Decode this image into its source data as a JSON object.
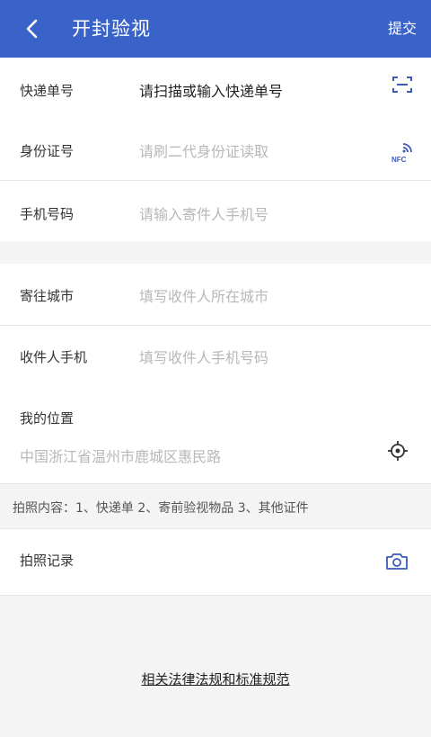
{
  "header": {
    "title": "开封验视",
    "submit_label": "提交",
    "background": "#3a63c9"
  },
  "section1": {
    "rows": [
      {
        "label": "快递单号",
        "placeholder": "请扫描或输入快递单号",
        "icon": "scan-icon"
      },
      {
        "label": "身份证号",
        "placeholder": "请刷二代身份证读取",
        "icon": "nfc-icon",
        "icon_text": "NFC"
      },
      {
        "label": "手机号码",
        "placeholder": "请输入寄件人手机号"
      }
    ]
  },
  "section2": {
    "rows": [
      {
        "label": "寄往城市",
        "placeholder": "填写收件人所在城市"
      },
      {
        "label": "收件人手机",
        "placeholder": "填写收件人手机号码"
      }
    ],
    "location": {
      "label": "我的位置",
      "value": "中国浙江省温州市鹿城区惠民路",
      "icon": "locate-icon"
    }
  },
  "photo_tip": "拍照内容：1、快递单 2、寄前验视物品 3、其他证件",
  "photo_record": {
    "label": "拍照记录",
    "icon": "camera-icon"
  },
  "law_link": "相关法律法规和标准规范"
}
